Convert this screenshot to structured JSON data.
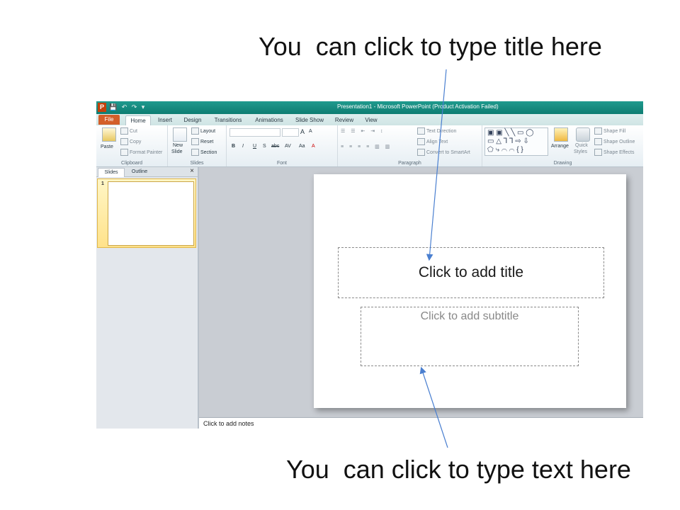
{
  "callouts": {
    "top": "You  can click to type title here",
    "bottom": "You  can click to type text here"
  },
  "window": {
    "app_icon": "P",
    "quick_access": "💾 ↶ ↷ ▾",
    "title": "Presentation1 - Microsoft PowerPoint (Product Activation Failed)"
  },
  "ribbon_tabs": [
    "File",
    "Home",
    "Insert",
    "Design",
    "Transitions",
    "Animations",
    "Slide Show",
    "Review",
    "View"
  ],
  "clipboard": {
    "paste": "Paste",
    "cut": "Cut",
    "copy": "Copy",
    "format_painter": "Format Painter",
    "label": "Clipboard"
  },
  "slides_group": {
    "new_slide": "New",
    "new_slide_2": "Slide",
    "layout": "Layout",
    "reset": "Reset",
    "section": "Section",
    "label": "Slides"
  },
  "font_group": {
    "bold": "B",
    "italic": "I",
    "underline": "U",
    "strike": "S",
    "abc": "abc",
    "spacing": "AV",
    "case": "Aa",
    "color": "A",
    "grow": "A",
    "shrink": "A",
    "label": "Font"
  },
  "paragraph_group": {
    "text_direction": "Text Direction",
    "align_text": "Align Text",
    "convert": "Convert to SmartArt",
    "label": "Paragraph"
  },
  "drawing_group": {
    "arrange": "Arrange",
    "quick_styles": "Quick",
    "quick_styles_2": "Styles",
    "shape_fill": "Shape Fill",
    "shape_outline": "Shape Outline",
    "shape_effects": "Shape Effects",
    "label": "Drawing"
  },
  "left_pane": {
    "tab_slides": "Slides",
    "tab_outline": "Outline",
    "close": "×",
    "slide_number": "1"
  },
  "slide": {
    "title_placeholder": "Click to add title",
    "subtitle_placeholder": "Click to add subtitle"
  },
  "notes": {
    "placeholder": "Click to add notes"
  },
  "colors": {
    "title_bar": "#1f9a8e",
    "file_tab": "#d35f2a",
    "arrow": "#4a7fd0"
  }
}
